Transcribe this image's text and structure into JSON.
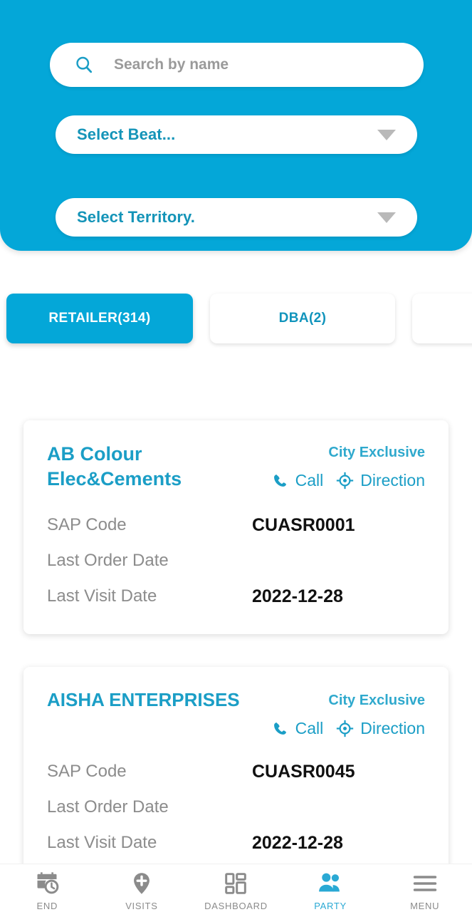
{
  "theme": {
    "primary": "#04A7D8",
    "accent_text": "#1b9ec6",
    "muted_text": "#8c8c8c",
    "value_text": "#111111",
    "nav_inactive": "#8b8b8b",
    "nav_active": "#2aa9d4"
  },
  "header": {
    "search": {
      "placeholder": "Search by name",
      "value": "",
      "icon": "search-icon"
    },
    "beat_select": {
      "label": "Select Beat...",
      "icon": "chevron-down-icon"
    },
    "territory_select": {
      "label": "Select Territory.",
      "icon": "chevron-down-icon"
    }
  },
  "tabs": [
    {
      "label": "RETAILER(314)",
      "active": true
    },
    {
      "label": "DBA(2)",
      "active": false
    },
    {
      "label": "",
      "active": false
    }
  ],
  "labels": {
    "sap_code": "SAP Code",
    "last_order_date": "Last Order Date",
    "last_visit_date": "Last Visit Date",
    "call": "Call",
    "direction": "Direction"
  },
  "cards": [
    {
      "title": "AB Colour Elec&Cements",
      "badge": "City Exclusive",
      "sap_code": "CUASR0001",
      "last_order_date": "",
      "last_visit_date": "2022-12-28"
    },
    {
      "title": "AISHA ENTERPRISES",
      "badge": "City Exclusive",
      "sap_code": "CUASR0045",
      "last_order_date": "",
      "last_visit_date": "2022-12-28"
    }
  ],
  "bottom_nav": [
    {
      "label": "END",
      "icon": "calendar-clock-icon",
      "active": false
    },
    {
      "label": "VISITS",
      "icon": "map-pin-plus-icon",
      "active": false
    },
    {
      "label": "DASHBOARD",
      "icon": "dashboard-grid-icon",
      "active": false
    },
    {
      "label": "PARTY",
      "icon": "people-icon",
      "active": true
    },
    {
      "label": "MENU",
      "icon": "hamburger-icon",
      "active": false
    }
  ]
}
